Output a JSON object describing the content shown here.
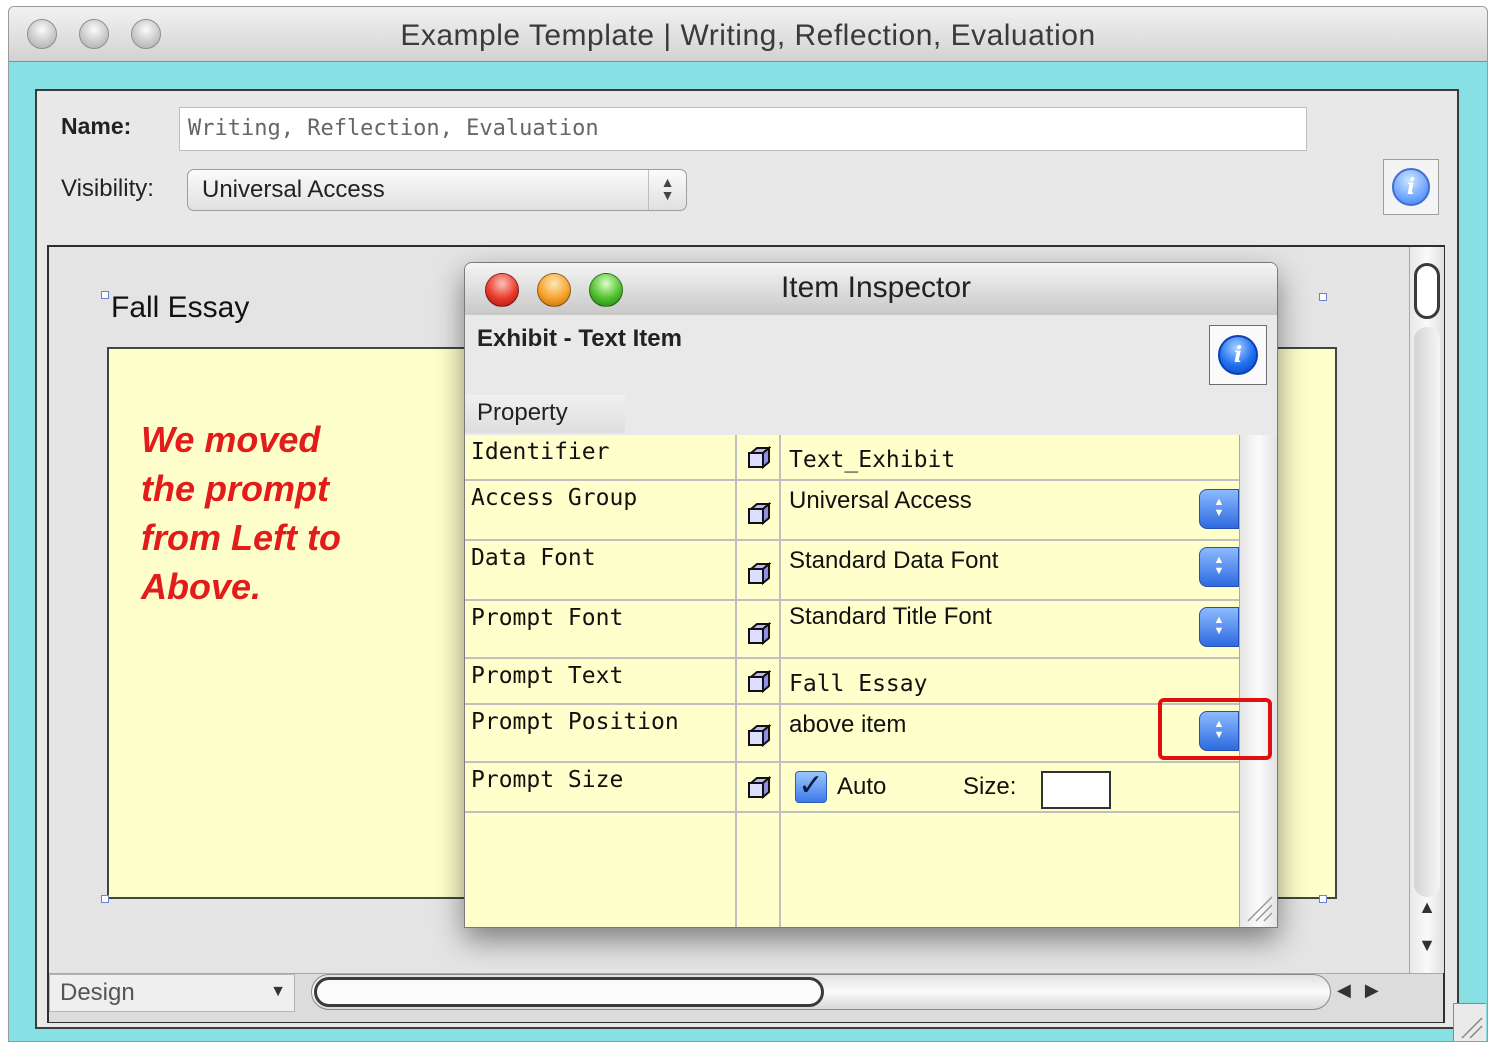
{
  "window": {
    "title": "Example Template | Writing, Reflection, Evaluation"
  },
  "form": {
    "name_label": "Name:",
    "name_value": "Writing, Reflection, Evaluation",
    "visibility_label": "Visibility:",
    "visibility_value": "Universal Access"
  },
  "layout": {
    "prompt_title": "Fall Essay",
    "note_lines": [
      "We moved",
      "the prompt",
      "from Left to",
      "Above."
    ],
    "mode": "Design"
  },
  "inspector": {
    "title": "Item Inspector",
    "item_kind": "Exhibit - Text Item",
    "property_header": "Property",
    "rows": [
      {
        "property": "Identifier",
        "value": "Text_Exhibit"
      },
      {
        "property": "Access Group",
        "value": "Universal Access"
      },
      {
        "property": "Data Font",
        "value": "Standard Data Font"
      },
      {
        "property": "Prompt Font",
        "value": "Standard Title Font"
      },
      {
        "property": "Prompt Text",
        "value": "Fall Essay"
      },
      {
        "property": "Prompt Position",
        "value": "above item"
      },
      {
        "property": "Prompt Size",
        "auto_label": "Auto",
        "size_label": "Size:",
        "auto_checked": true
      }
    ]
  },
  "icons": [
    "info-icon",
    "cube-icon",
    "stepper-icon",
    "checkbox-icon",
    "resize-grip-icon"
  ],
  "colors": {
    "window_frame": "#86e0e4",
    "inspector_bg": "#ffffcc",
    "note_text": "#e21b1b",
    "highlight": "#e01010"
  }
}
